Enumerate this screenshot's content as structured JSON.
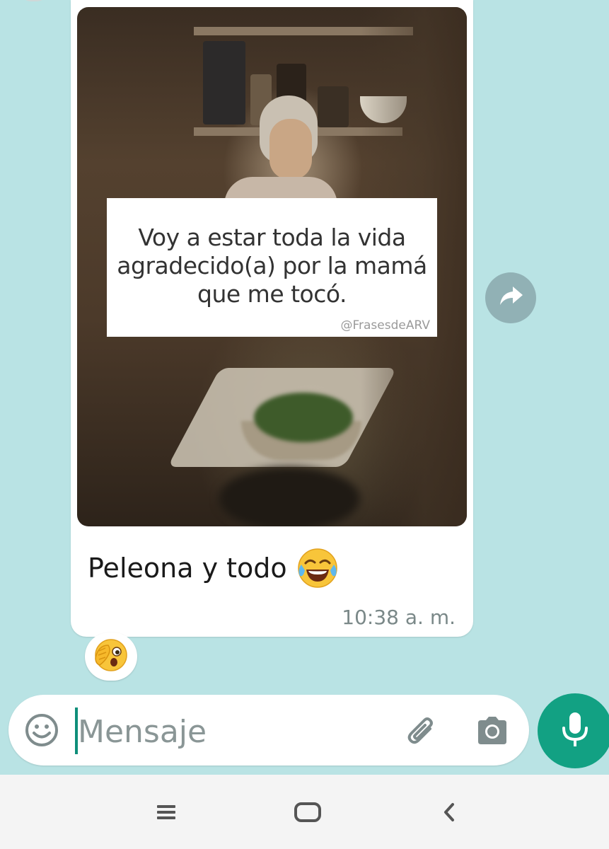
{
  "colors": {
    "chat_background": "#b9e3e4",
    "accent_green": "#12a183",
    "caret_color": "#0f8f7a",
    "forward_button": "#91b1b5"
  },
  "message": {
    "image": {
      "quote_text": "Voy a estar toda la vida agradecido(a) por la mamá que me tocó.",
      "handle": "@FrasesdeARV"
    },
    "caption": "Peleona y todo",
    "caption_emoji": "face-with-tears-of-joy",
    "timestamp": "10:38 a. m.",
    "reaction_emoji": "face-with-hand-over-mouth-peeking"
  },
  "forward_button": {
    "icon": "forward-arrow-icon"
  },
  "composer": {
    "placeholder": "Mensaje",
    "value": "",
    "emoji_icon": "smiley-icon",
    "attach_icon": "paperclip-icon",
    "camera_icon": "camera-icon",
    "mic_icon": "microphone-icon"
  },
  "system_nav": {
    "recents_icon": "menu-lines-icon",
    "home_icon": "home-rounded-rect-icon",
    "back_icon": "back-chevron-icon"
  }
}
